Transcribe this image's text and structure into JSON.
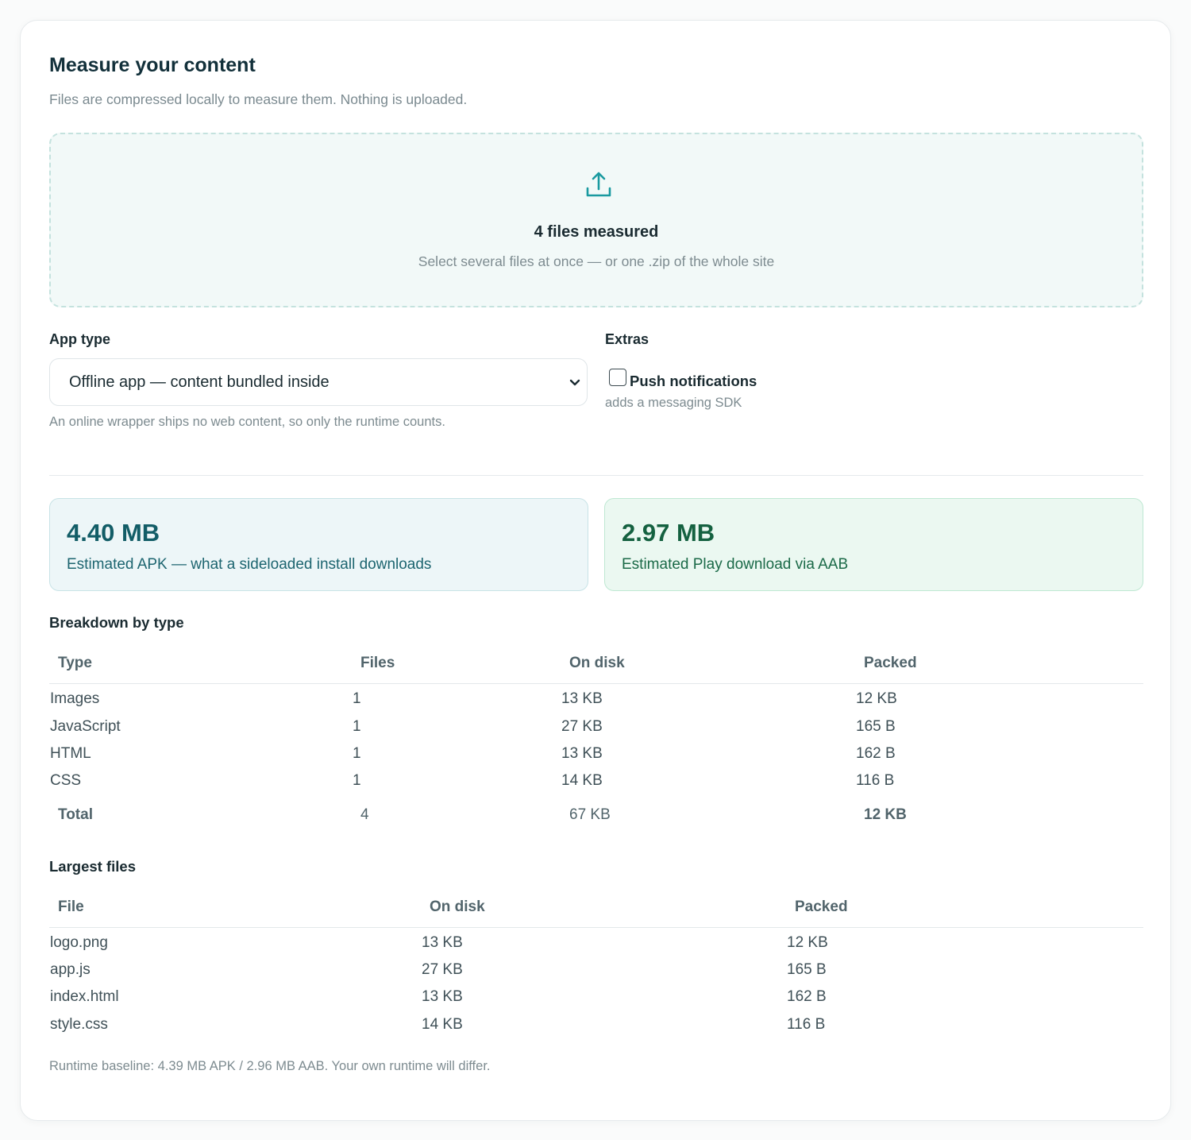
{
  "header": {
    "title": "Measure your content",
    "subtitle": "Files are compressed locally to measure them. Nothing is uploaded."
  },
  "dropzone": {
    "icon": "upload-icon",
    "title": "4 files measured",
    "subtitle": "Select several files at once — or one .zip of the whole site"
  },
  "app_type": {
    "label": "App type",
    "selected": "Offline app — content bundled inside",
    "hint": "An online wrapper ships no web content, so only the runtime counts."
  },
  "extras": {
    "label": "Extras",
    "push_label": "Push notifications",
    "push_checked": false,
    "push_hint": "adds a messaging SDK"
  },
  "stats": {
    "apk_value": "4.40 MB",
    "apk_desc": "Estimated APK — what a sideloaded install downloads",
    "aab_value": "2.97 MB",
    "aab_desc": "Estimated Play download via AAB"
  },
  "breakdown": {
    "title": "Breakdown by type",
    "columns": [
      "Type",
      "Files",
      "On disk",
      "Packed"
    ],
    "rows": [
      [
        "Images",
        "1",
        "13 KB",
        "12 KB"
      ],
      [
        "JavaScript",
        "1",
        "27 KB",
        "165 B"
      ],
      [
        "HTML",
        "1",
        "13 KB",
        "162 B"
      ],
      [
        "CSS",
        "1",
        "14 KB",
        "116 B"
      ]
    ],
    "total": [
      "Total",
      "4",
      "67 KB",
      "12 KB"
    ]
  },
  "largest": {
    "title": "Largest files",
    "columns": [
      "File",
      "On disk",
      "Packed"
    ],
    "rows": [
      [
        "logo.png",
        "13 KB",
        "12 KB"
      ],
      [
        "app.js",
        "27 KB",
        "165 B"
      ],
      [
        "index.html",
        "13 KB",
        "162 B"
      ],
      [
        "style.css",
        "14 KB",
        "116 B"
      ]
    ]
  },
  "footnote": "Runtime baseline: 4.39 MB APK / 2.96 MB AAB. Your own runtime will differ.",
  "colors": {
    "accent": "#1a9aa0",
    "apk_bg": "#edf6f8",
    "aab_bg": "#ebf8f1"
  }
}
